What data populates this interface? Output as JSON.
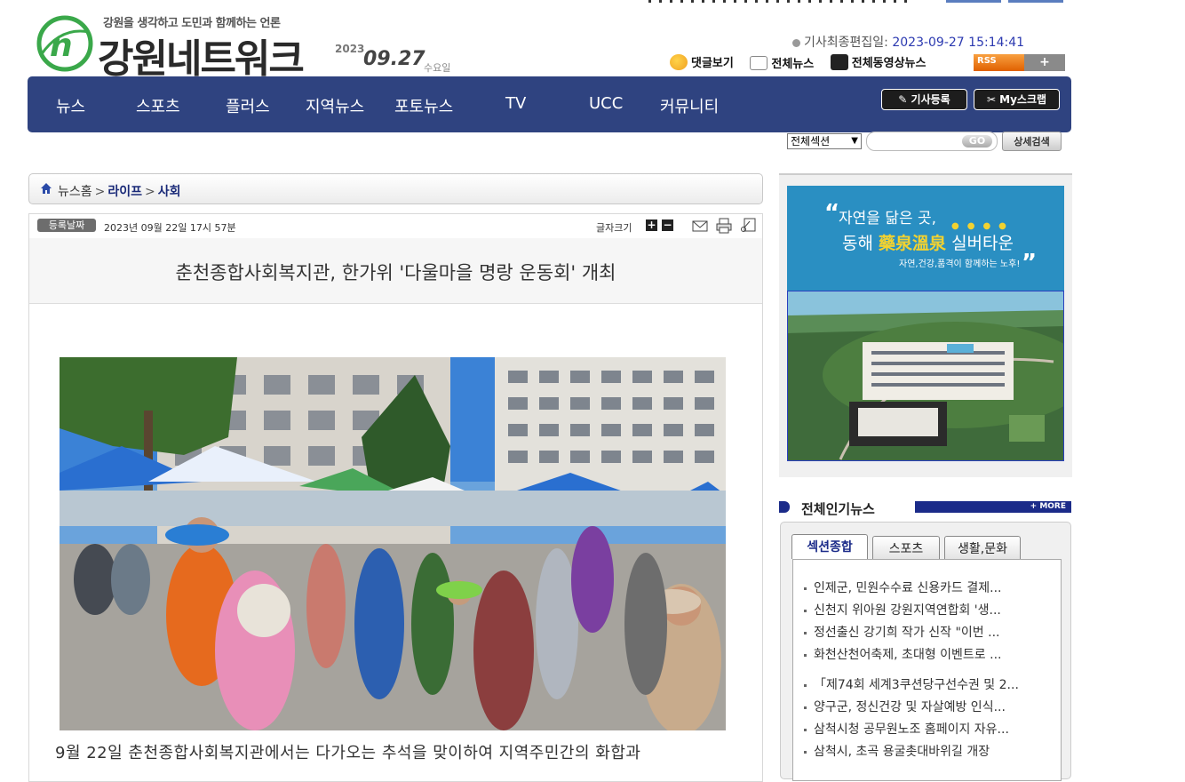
{
  "header": {
    "tagline": "강원을 생각하고 도민과 함께하는 언론",
    "site_name": "강원네트워크",
    "date_year": "2023",
    "date_md": "09.27",
    "date_dow": "수요일",
    "last_edit_label": "기사최종편집일:",
    "last_edit_value": "2023-09-27 15:14:41",
    "util_links": [
      "댓글보기",
      "전체뉴스",
      "전체동영상뉴스"
    ],
    "rss_label": "RSS",
    "rss_plus": "+"
  },
  "nav": {
    "items": [
      "뉴스",
      "스포츠",
      "플러스",
      "지역뉴스",
      "포토뉴스",
      "TV",
      "UCC",
      "커뮤니티"
    ],
    "register_button": "기사등록",
    "myscrap_button": "My스크랩"
  },
  "search": {
    "select_value": "전체섹션",
    "go_label": "GO",
    "detail_label": "상세검색"
  },
  "breadcrumb": {
    "home": "뉴스홈",
    "level1": "라이프",
    "level2": "사회"
  },
  "article": {
    "reg_badge": "등록날짜",
    "reg_date": "2023년 09월 22일  17시 57분",
    "font_size_label": "글자크기",
    "title": "춘천종합사회복지관, 한가위 '다울마을 명랑 운동회' 개최",
    "lead": "9월 22일 춘천종합사회복지관에서는 다가오는 추석을 맞이하여 지역주민간의 화합과"
  },
  "ad": {
    "line1": "자연을 닮은 곳,",
    "line2_prefix": "동해",
    "line2_gold": "藥泉溫泉",
    "line2_suffix": "실버타운",
    "line3": "자연,건강,품격이 함께하는 노후!"
  },
  "popular": {
    "title": "전체인기뉴스",
    "more_label": "+ MORE",
    "tabs": [
      "섹션종합",
      "스포츠",
      "생활,문화"
    ],
    "items": [
      "인제군, 민원수수료 신용카드 결제...",
      "신천지 위아원 강원지역연합회 '생...",
      "정선출신 강기희 작가 신작 \"이번 ...",
      "화천산천어축제, 초대형 이벤트로 ...",
      "「제74회 세계3쿠션당구선수권 및 2...",
      "양구군, 정신건강 및 자살예방 인식...",
      "삼척시청 공무원노조 홈페이지 자유...",
      "삼척시, 초곡 용굴촛대바위길 개장"
    ]
  },
  "colors": {
    "nav_bg": "#2f4380",
    "accent_navy": "#1b2b89",
    "edit_time": "#2b39b0",
    "logo_green": "#3aa84a"
  }
}
